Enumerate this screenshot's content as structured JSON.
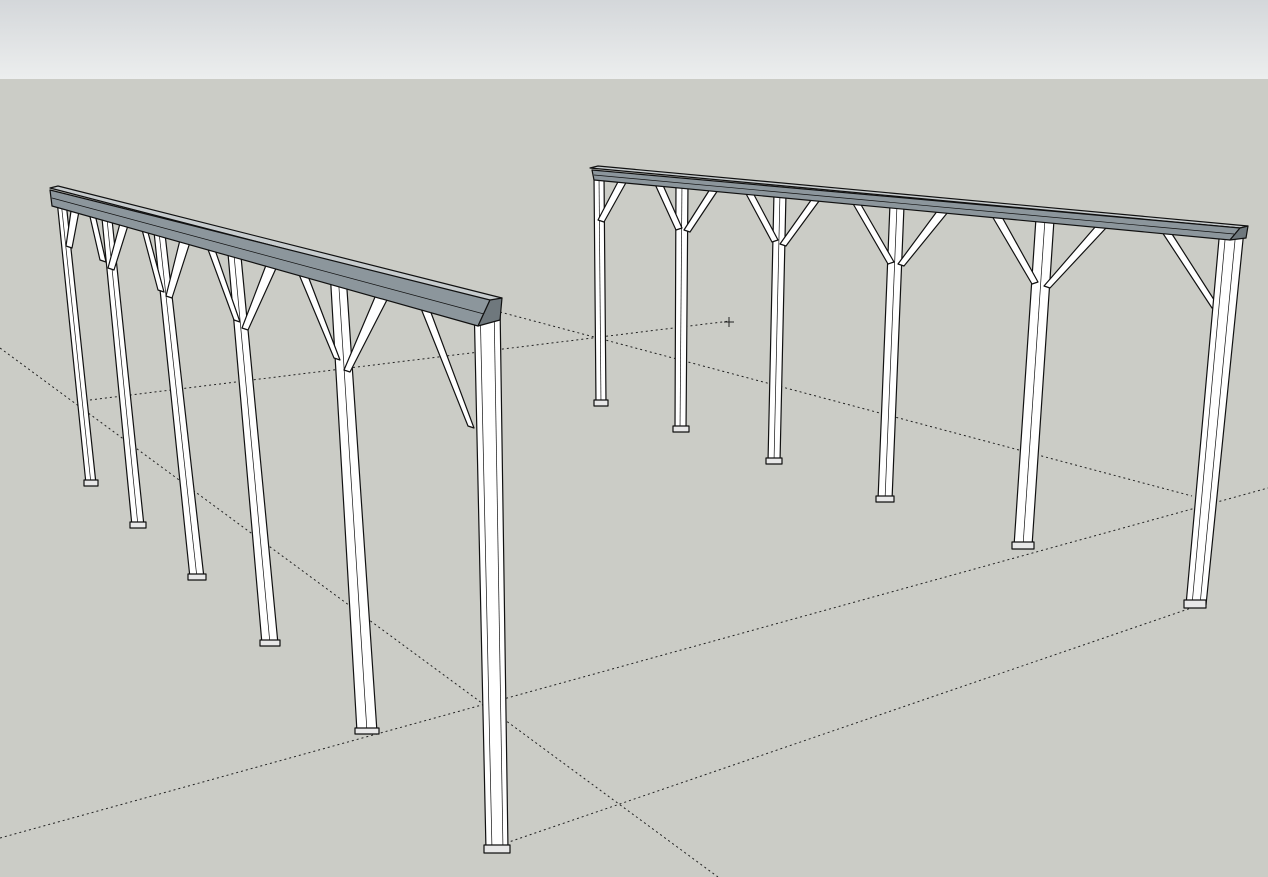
{
  "viewport": {
    "sky_color_top": "#d4d7da",
    "sky_color_bottom": "#eceeee",
    "ground_color": "#cbccc6"
  },
  "model": {
    "beam_color": "#8c969c",
    "column_color": "#ffffff",
    "edge_color": "#111111",
    "frames": [
      {
        "name": "left-frame",
        "columns": 6
      },
      {
        "name": "right-frame",
        "columns": 6
      }
    ]
  },
  "axes": {
    "style": "dotted",
    "color": "#222222"
  }
}
